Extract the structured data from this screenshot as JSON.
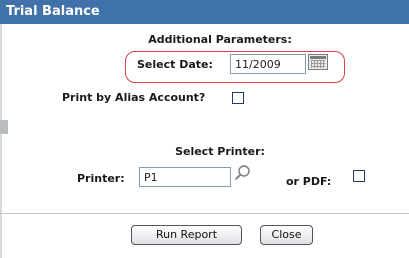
{
  "window": {
    "title": "Trial Balance"
  },
  "parameters": {
    "heading": "Additional Parameters:",
    "select_date_label": "Select Date:",
    "select_date_value": "11/2009",
    "alias_label": "Print by Alias Account?",
    "alias_checked": false
  },
  "printer": {
    "heading": "Select Printer:",
    "printer_label": "Printer:",
    "printer_value": "P1",
    "pdf_label": "or PDF:",
    "pdf_checked": false
  },
  "actions": {
    "run_label": "Run Report",
    "close_label": "Close"
  },
  "colors": {
    "titlebar": "#3f72a8",
    "highlight": "#d94242"
  },
  "icons": [
    "calendar-icon",
    "magnifier-icon"
  ]
}
